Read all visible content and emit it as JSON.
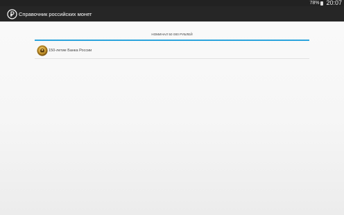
{
  "status_bar": {
    "battery": "78%",
    "time": "20:07"
  },
  "app_bar": {
    "title": "Справочник российских монет",
    "icon": "ruble-icon"
  },
  "tabs": [
    {
      "label": "НОМИНАЛ 50 000 РУБЛЕЙ"
    }
  ],
  "colors": {
    "accent": "#2aa3dd",
    "app_bar": "#262626",
    "status_bar": "#222222"
  },
  "coins": [
    {
      "label": "150-летие Банка России",
      "icon": "coin-icon"
    }
  ]
}
